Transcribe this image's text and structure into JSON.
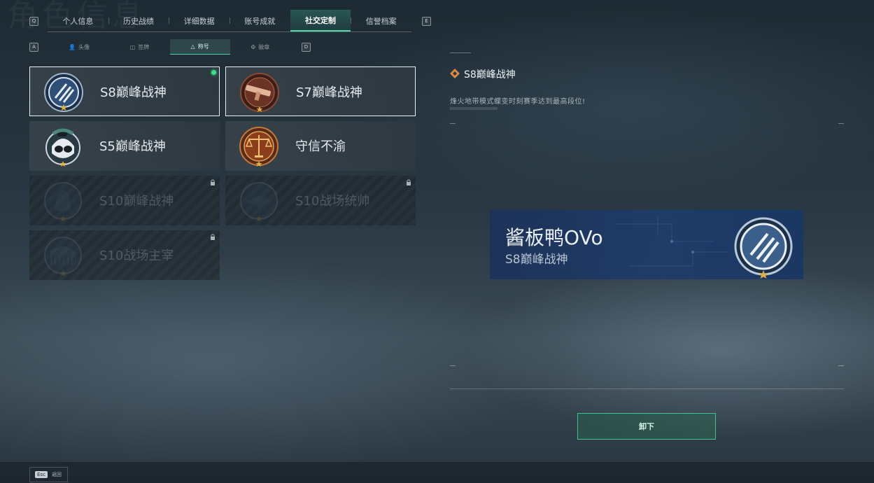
{
  "header": {
    "bg_title": "角色信息",
    "left_key": "Q",
    "right_key": "E",
    "tabs": [
      {
        "label": "个人信息",
        "active": false
      },
      {
        "label": "历史战绩",
        "active": false
      },
      {
        "label": "详细数据",
        "active": false
      },
      {
        "label": "账号成就",
        "active": false
      },
      {
        "label": "社交定制",
        "active": true
      },
      {
        "label": "信誉档案",
        "active": false
      }
    ]
  },
  "subnav": {
    "left_key": "A",
    "right_key": "D",
    "tabs": [
      {
        "label": "头像",
        "icon": "person-icon",
        "active": false
      },
      {
        "label": "签牌",
        "icon": "plate-icon",
        "active": false
      },
      {
        "label": "称号",
        "icon": "title-icon",
        "active": true
      },
      {
        "label": "徽章",
        "icon": "badge-icon",
        "active": false
      }
    ]
  },
  "titles": [
    {
      "name": "S8巅峰战神",
      "state": "equipped",
      "emblem": "s8-emblem-icon"
    },
    {
      "name": "S7巅峰战神",
      "state": "unlocked",
      "emblem": "s7-emblem-icon"
    },
    {
      "name": "S5巅峰战神",
      "state": "unlocked",
      "emblem": "s5-emblem-icon"
    },
    {
      "name": "守信不渝",
      "state": "unlocked",
      "emblem": "scales-emblem-icon"
    },
    {
      "name": "S10巅峰战神",
      "state": "locked",
      "emblem": "s10-peak-emblem-icon"
    },
    {
      "name": "S10战场统帅",
      "state": "locked",
      "emblem": "s10-commander-emblem-icon"
    },
    {
      "name": "S10战场主宰",
      "state": "locked",
      "emblem": "s10-ruler-emblem-icon"
    }
  ],
  "detail": {
    "title": "S8巅峰战神",
    "description": "烽火地带模式蝶变时刻赛季达到最高段位!",
    "banner_player_name": "酱板鸭OVo",
    "banner_title": "S8巅峰战神",
    "action_label": "卸下"
  },
  "footer": {
    "esc_key": "Esc",
    "back_label": "返回"
  },
  "colors": {
    "accent": "#4fd3a8",
    "equipped_dot": "#38e08a",
    "banner_blue": "#1e3c69"
  }
}
